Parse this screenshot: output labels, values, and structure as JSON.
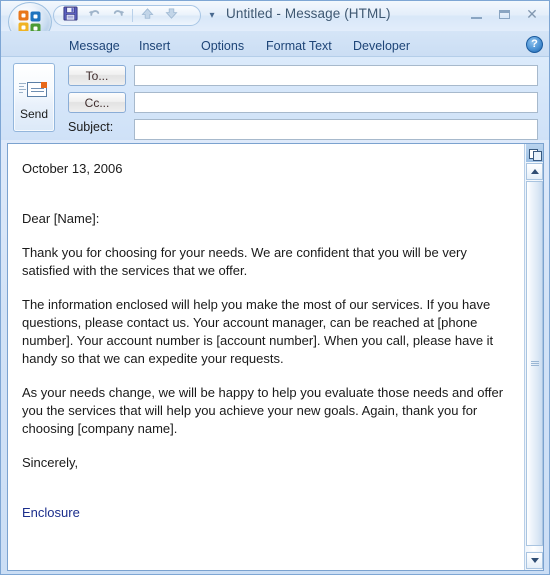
{
  "window": {
    "title": "Untitled - Message (HTML)",
    "orb_name": "Office Button",
    "min_label": "Minimize",
    "max_label": "Maximize",
    "close_label": "Close"
  },
  "quick_access": {
    "items": [
      {
        "name": "save-icon",
        "label": "Save"
      },
      {
        "name": "undo-icon",
        "label": "Undo"
      },
      {
        "name": "redo-icon",
        "label": "Redo"
      },
      {
        "name": "previous-item-icon",
        "label": "Previous Item"
      },
      {
        "name": "next-item-icon",
        "label": "Next Item"
      }
    ],
    "customize_label": "Customize Quick Access Toolbar"
  },
  "ribbon": {
    "tabs": [
      {
        "label": "Message"
      },
      {
        "label": "Insert"
      },
      {
        "label": "Options"
      },
      {
        "label": "Format Text"
      },
      {
        "label": "Developer"
      }
    ],
    "help_label": "?"
  },
  "header": {
    "send_label": "Send",
    "to_label": "To...",
    "cc_label": "Cc...",
    "subject_label": "Subject:",
    "to_value": "",
    "cc_value": "",
    "subject_value": "",
    "to_placeholder": "",
    "cc_placeholder": "",
    "subject_placeholder": ""
  },
  "body": {
    "date": "October 13, 2006",
    "salutation": "Dear [Name]:",
    "paragraph1": "Thank you for choosing for your needs. We are confident that you will be very satisfied with the services that we offer.",
    "paragraph2": "The information enclosed will help you make the most of our services. If you have questions, please contact us. Your account manager, can be reached at [phone number]. Your account number is [account number]. When you call, please have it handy so that we can expedite your requests.",
    "paragraph3": "As your needs change, we will be happy to help you evaluate those needs and offer you the services that will help you achieve your new goals. Again, thank you for choosing [company name].",
    "closing": "Sincerely,",
    "enclosure": "Enclosure"
  },
  "scrollbar": {
    "browse_object_label": "Select Browse Object",
    "up_label": "Scroll Up",
    "down_label": "Scroll Down"
  },
  "colors": {
    "accent": "#1d4477",
    "enclosure_text": "#1b2e8c",
    "window_border": "#7ea6d4",
    "orb_orange": "#e8761a",
    "orb_blue": "#1e73be",
    "orb_yellow": "#f0b323",
    "orb_green": "#4b9b35",
    "send_flag": "#e8691a"
  }
}
